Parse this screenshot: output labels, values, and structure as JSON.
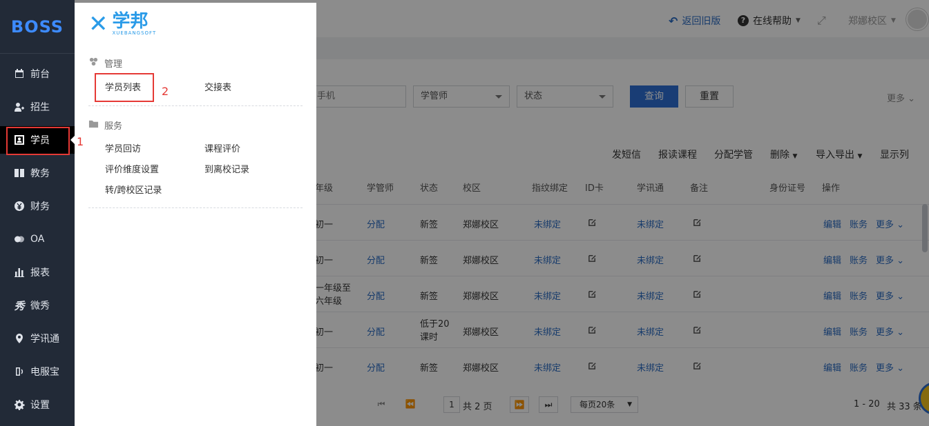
{
  "sidebar": {
    "brand": "BOSS",
    "items": [
      {
        "label": "前台",
        "icon": "calendar-icon"
      },
      {
        "label": "招生",
        "icon": "user-add-icon"
      },
      {
        "label": "学员",
        "icon": "id-card-icon"
      },
      {
        "label": "教务",
        "icon": "book-icon"
      },
      {
        "label": "财务",
        "icon": "yen-icon"
      },
      {
        "label": "OA",
        "icon": "chat-icon"
      },
      {
        "label": "报表",
        "icon": "bar-chart-icon"
      },
      {
        "label": "微秀",
        "icon": "xiu-icon"
      },
      {
        "label": "学讯通",
        "icon": "location-icon"
      },
      {
        "label": "电服宝",
        "icon": "phone-icon"
      },
      {
        "label": "设置",
        "icon": "gear-icon"
      }
    ],
    "active_index": 2
  },
  "annotations": {
    "label1": "1",
    "label2": "2"
  },
  "topbar": {
    "back_label": "返回旧版",
    "help_label": "在线帮助",
    "campus_label": "郑娜校区"
  },
  "filters": {
    "phone_placeholder": "手机",
    "manager_select": "学管师",
    "status_select": "状态",
    "query_button": "查询",
    "reset_button": "重置",
    "more_label": "更多"
  },
  "toolbar": {
    "sms": "发短信",
    "enroll": "报读课程",
    "assign": "分配学管",
    "delete": "删除",
    "import_export": "导入导出",
    "columns": "显示列"
  },
  "table": {
    "headers": [
      "年级",
      "学管师",
      "状态",
      "校区",
      "指纹绑定",
      "ID卡",
      "学讯通",
      "备注",
      "身份证号",
      "操作"
    ],
    "rows": [
      {
        "grade": "初一",
        "manager": "分配",
        "status": "新签",
        "campus": "郑娜校区",
        "fingerprint": "未绑定",
        "xunxun": "未绑定"
      },
      {
        "grade": "初一",
        "manager": "分配",
        "status": "新签",
        "campus": "郑娜校区",
        "fingerprint": "未绑定",
        "xunxun": "未绑定"
      },
      {
        "grade": "一年级至六年级",
        "manager": "分配",
        "status": "新签",
        "campus": "郑娜校区",
        "fingerprint": "未绑定",
        "xunxun": "未绑定"
      },
      {
        "grade": "初一",
        "manager": "分配",
        "status": "低于20课时",
        "campus": "郑娜校区",
        "fingerprint": "未绑定",
        "xunxun": "未绑定"
      },
      {
        "grade": "初一",
        "manager": "分配",
        "status": "新签",
        "campus": "郑娜校区",
        "fingerprint": "未绑定",
        "xunxun": "未绑定"
      }
    ],
    "actions": {
      "edit": "编辑",
      "account": "账务",
      "more": "更多"
    }
  },
  "pager": {
    "current_page": "1",
    "total_pages": "共 2 页",
    "page_size": "每页20条",
    "range": "1 - 20",
    "total": "共 33 条"
  },
  "menu": {
    "logo_cn": "学邦",
    "logo_en": "XUEBANGSOFT",
    "groups": [
      {
        "title": "管理",
        "icon": "gear-cluster-icon",
        "links": [
          "学员列表",
          "交接表"
        ]
      },
      {
        "title": "服务",
        "icon": "folder-icon",
        "links": [
          "学员回访",
          "课程评价",
          "评价维度设置",
          "到离校记录",
          "转/跨校区记录"
        ]
      }
    ]
  }
}
